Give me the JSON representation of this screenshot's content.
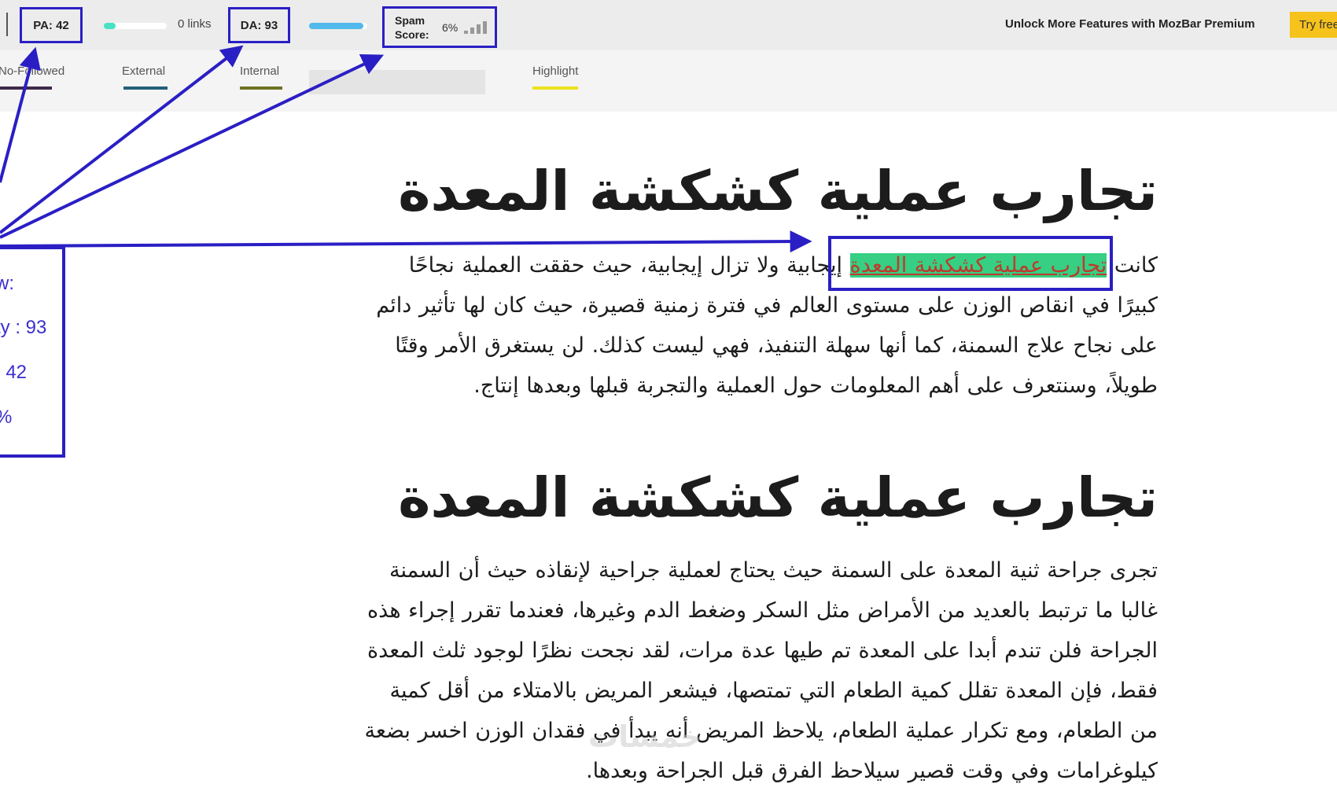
{
  "mozbar": {
    "pa_label": "PA: 42",
    "da_label": "DA: 93",
    "links_text": "0 links",
    "spam_label": "Spam Score:",
    "spam_value": "6%",
    "premium_text": "Unlock More Features with MozBar Premium",
    "try_button": "Try free",
    "legend": {
      "nofollowed": "No-Followed",
      "external": "External",
      "internal": "Internal",
      "highlight": "Highlight"
    },
    "colors": {
      "pa_bar": "#47e2c2",
      "da_bar": "#51b9ec",
      "nofollowed": "#3e2a4a",
      "external": "#235f78",
      "internal": "#6e7223",
      "highlight": "#ece21c",
      "annotation": "#2a1fc4"
    },
    "pa_bar_fraction": 0.42,
    "da_bar_fraction": 0.93
  },
  "annotation": {
    "line1": "w:",
    "line2": "ty : 93",
    "line3": ": 42",
    "line4": "%"
  },
  "article": {
    "heading1": "تجارب عملية كشكشة المعدة",
    "para1_before": "كانت ",
    "para1_link": "تجارب عملية كشكشة المعدة",
    "para1_after": " إيجابية ولا تزال إيجابية، حيث حققت العملية نجاحًا كبيرًا في انقاص الوزن على مستوى العالم في فترة زمنية قصيرة، حيث كان لها تأثير دائم على نجاح علاج السمنة، كما أنها سهلة التنفيذ، فهي ليست كذلك. لن يستغرق الأمر وقتًا طويلاً، وسنتعرف على أهم المعلومات حول العملية والتجربة قبلها وبعدها إنتاج.",
    "heading2": "تجارب عملية كشكشة المعدة",
    "para2": "تجرى جراحة ثنية المعدة على السمنة حيث يحتاج لعملية جراحية لإنقاذه حيث أن السمنة غالبا ما ترتبط بالعديد من الأمراض مثل السكر وضغط الدم وغيرها، فعندما تقرر إجراء هذه الجراحة فلن تندم أبدا على المعدة تم طيها عدة مرات، لقد نجحت نظرًا لوجود ثلث المعدة فقط، فإن المعدة تقلل كمية الطعام التي تمتصها، فيشعر المريض بالامتلاء من أقل كمية من الطعام، ومع تكرار عملية الطعام، يلاحظ المريض أنه يبدأ في فقدان الوزن اخسر بضعة كيلوغرامات وفي وقت قصير سيلاحظ الفرق قبل الجراحة وبعدها."
  },
  "watermark": "خمسات"
}
